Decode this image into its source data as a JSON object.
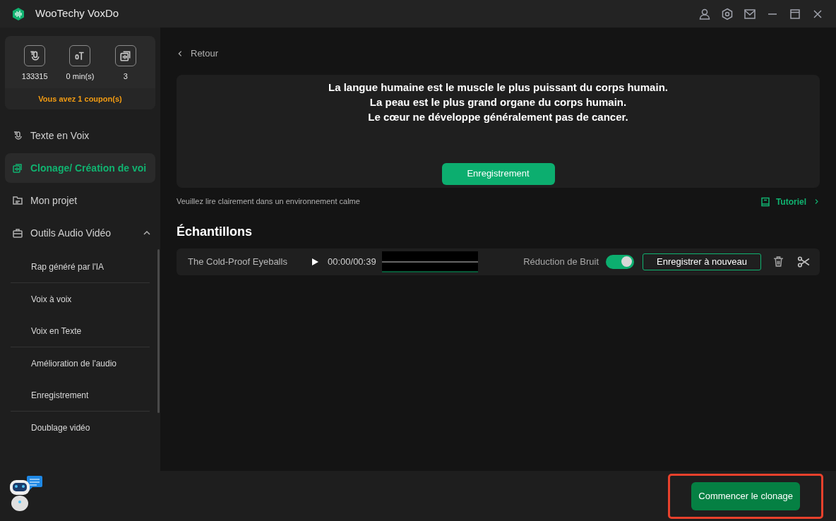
{
  "window": {
    "title": "WooTechy VoxDo"
  },
  "stats": {
    "items": [
      {
        "kind": "tts",
        "value": "133315"
      },
      {
        "kind": "minutes",
        "value": "0 min(s)"
      },
      {
        "kind": "clone",
        "value": "3"
      }
    ],
    "coupon": "Vous avez 1 coupon(s)"
  },
  "sidebar": {
    "items": [
      {
        "kind": "tts",
        "label": "Texte en Voix",
        "selected": false
      },
      {
        "kind": "clone",
        "label": "Clonage/ Création de voi",
        "selected": true
      },
      {
        "kind": "project",
        "label": "Mon projet",
        "selected": false
      },
      {
        "kind": "tools",
        "label": "Outils Audio Vidéo",
        "selected": false,
        "expanded": true,
        "groups": [
          [
            "Rap généré par l'IA"
          ],
          [
            "Voix à voix",
            "Voix en Texte"
          ],
          [
            "Amélioration de l'audio",
            "Enregistrement"
          ],
          [
            "Doublage vidéo"
          ]
        ]
      }
    ]
  },
  "back": "Retour",
  "script_lines": [
    "La langue humaine est le muscle le plus puissant du corps humain.",
    "La peau est le plus grand organe du corps humain.",
    "Le cœur ne développe généralement pas de cancer."
  ],
  "record_button": "Enregistrement",
  "hint": "Veuillez lire clairement dans un environnement calme",
  "tutorial": "Tutoriel",
  "samples": {
    "title": "Échantillons",
    "rows": [
      {
        "name": "The Cold-Proof Eyeballs",
        "time": "00:00/00:39",
        "noise_label": "Réduction de Bruit",
        "noise_on": true,
        "rerecord": "Enregistrer à nouveau"
      }
    ]
  },
  "start_button": "Commencer le clonage"
}
